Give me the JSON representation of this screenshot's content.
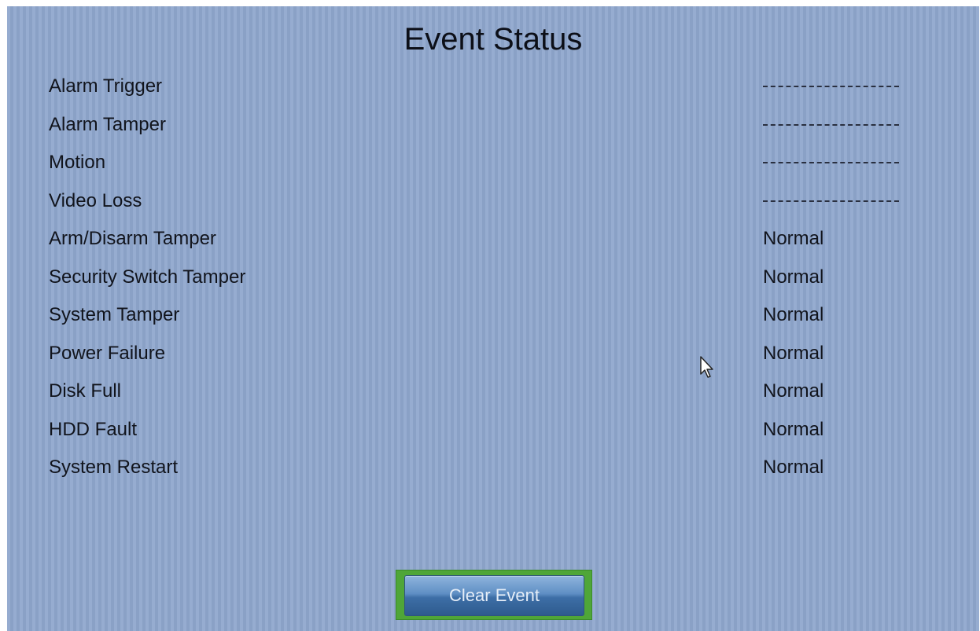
{
  "page": {
    "title": "Event Status"
  },
  "events": [
    {
      "label": "Alarm Trigger",
      "status": "",
      "status_type": "dash"
    },
    {
      "label": "Alarm Tamper",
      "status": "",
      "status_type": "dash"
    },
    {
      "label": "Motion",
      "status": "",
      "status_type": "dash"
    },
    {
      "label": "Video Loss",
      "status": "",
      "status_type": "dash"
    },
    {
      "label": "Arm/Disarm Tamper",
      "status": "Normal",
      "status_type": "text"
    },
    {
      "label": "Security Switch Tamper",
      "status": "Normal",
      "status_type": "text"
    },
    {
      "label": "System Tamper",
      "status": "Normal",
      "status_type": "text"
    },
    {
      "label": "Power Failure",
      "status": "Normal",
      "status_type": "text"
    },
    {
      "label": "Disk Full",
      "status": "Normal",
      "status_type": "text"
    },
    {
      "label": "HDD Fault",
      "status": "Normal",
      "status_type": "text"
    },
    {
      "label": "System Restart",
      "status": "Normal",
      "status_type": "text"
    }
  ],
  "actions": {
    "clear_event_label": "Clear Event"
  },
  "colors": {
    "background": "#8ea6cc",
    "focus_highlight": "#4fa638",
    "button": "#4a7cb3"
  },
  "icons": {
    "cursor": "mouse-pointer-icon"
  }
}
